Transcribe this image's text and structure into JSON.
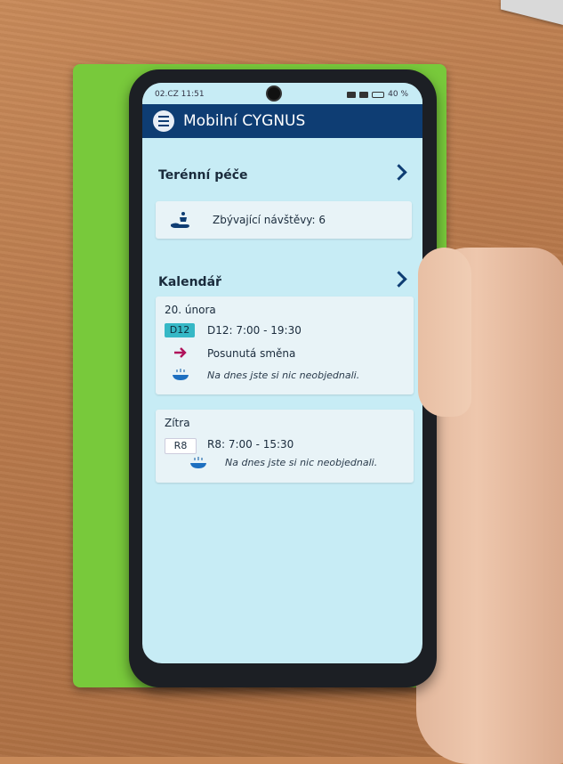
{
  "status_bar": {
    "time": "02.CZ 11:51",
    "battery": "40 %"
  },
  "app": {
    "title": "Mobilní CYGNUS"
  },
  "field_care": {
    "title": "Terénní péče",
    "remaining_visits_label": "Zbývající návštěvy: 6"
  },
  "calendar": {
    "title": "Kalendář",
    "days": [
      {
        "label": "20. února",
        "shift_badge": "D12",
        "shift_text": "D12: 7:00 - 19:30",
        "shift_changed": "Posunutá směna",
        "meal_text": "Na dnes jste si nic neobjednali."
      },
      {
        "label": "Zítra",
        "shift_badge": "R8",
        "shift_text": "R8: 7:00 - 15:30",
        "meal_text": "Na dnes jste si nic neobjednali."
      }
    ]
  },
  "colors": {
    "header": "#0e3d73",
    "screen_background": "#c7ecf5",
    "badge_active": "#36b8c6",
    "arrow_accent": "#b0125a",
    "wallet": "#78c93b"
  },
  "icons": {
    "menu": "hamburger-menu-icon",
    "visits": "hand-with-medicine-icon",
    "shift_changed": "arrow-right-icon",
    "meal": "meal-bowl-icon",
    "section_more": "chevron-right-icon"
  }
}
